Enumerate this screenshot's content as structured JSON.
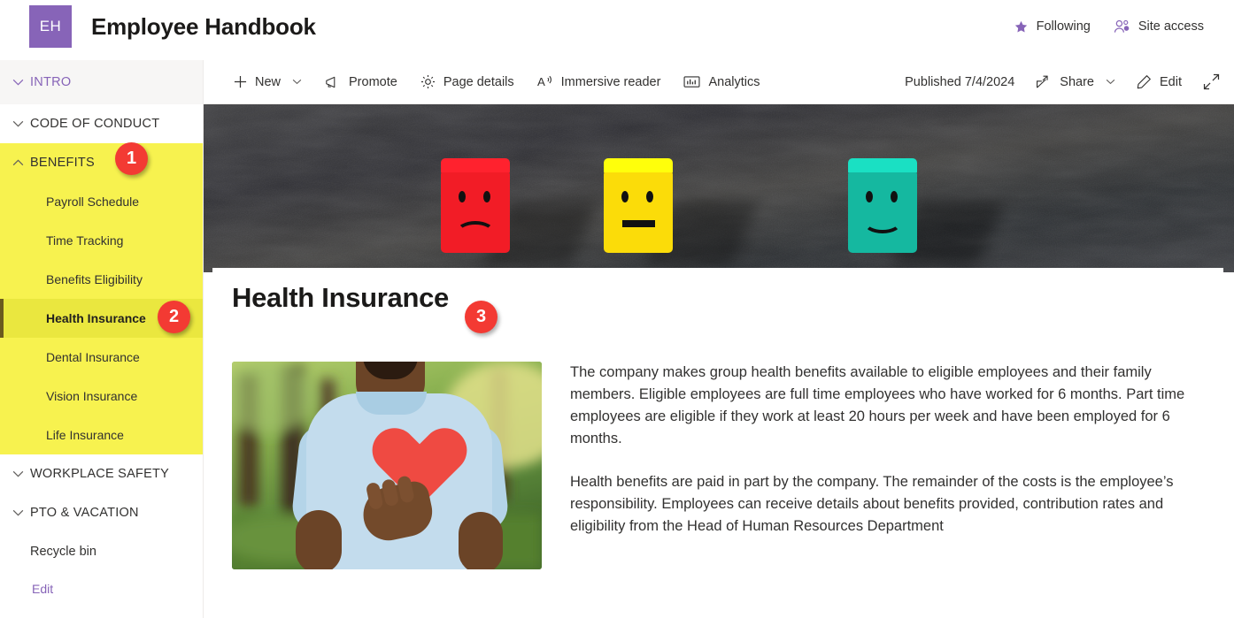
{
  "header": {
    "logo_initials": "EH",
    "site_title": "Employee Handbook",
    "following_label": "Following",
    "site_access_label": "Site access",
    "logo_color": "#8764b8",
    "accent_color": "#8764b8"
  },
  "command_bar": {
    "new_label": "New",
    "promote_label": "Promote",
    "page_details_label": "Page details",
    "immersive_reader_label": "Immersive reader",
    "analytics_label": "Analytics",
    "published_status": "Published 7/4/2024",
    "share_label": "Share",
    "edit_label": "Edit"
  },
  "sidebar": {
    "sections": [
      {
        "label": "INTRO",
        "expanded": true,
        "state": "current",
        "children": []
      },
      {
        "label": "CODE OF CONDUCT",
        "expanded": true,
        "state": "normal",
        "children": []
      },
      {
        "label": "BENEFITS",
        "expanded": true,
        "state": "highlighted",
        "children": [
          {
            "label": "Payroll Schedule",
            "selected": false
          },
          {
            "label": "Time Tracking",
            "selected": false
          },
          {
            "label": "Benefits Eligibility",
            "selected": false
          },
          {
            "label": "Health Insurance",
            "selected": true
          },
          {
            "label": "Dental Insurance",
            "selected": false
          },
          {
            "label": "Vision Insurance",
            "selected": false
          },
          {
            "label": "Life Insurance",
            "selected": false
          }
        ]
      },
      {
        "label": "WORKPLACE SAFETY",
        "expanded": true,
        "state": "normal",
        "children": []
      },
      {
        "label": "PTO & VACATION",
        "expanded": true,
        "state": "normal",
        "children": []
      }
    ],
    "recycle_bin_label": "Recycle bin",
    "edit_label": "Edit",
    "highlight_color": "#f7f24f",
    "selected_color": "#eae73f"
  },
  "hero": {
    "alt": "Three painted wooden blocks on a dark concrete wall showing a red sad face, a yellow neutral face and a teal happy face",
    "cubes": [
      {
        "name": "sad-face-block",
        "color": "#f21c26",
        "mood": "sad"
      },
      {
        "name": "neutral-face-block",
        "color": "#fbdc09",
        "mood": "neutral"
      },
      {
        "name": "happy-face-block",
        "color": "#15b8a0",
        "mood": "happy"
      }
    ]
  },
  "page": {
    "title": "Health Insurance",
    "image_alt": "Man in a light blue t-shirt holding a red paper heart over his chest in a park",
    "paragraphs": [
      "The company makes group health benefits available to eligible employees and their family members. Eligible employees are full time employees who have worked for 6 months. Part time employees are eligible if they work at least 20 hours per week and have been employed for 6 months.",
      "Health benefits are paid in part by the company. The remainder of the costs is the employee’s responsibility. Employees can receive details about benefits provided, contribution rates and eligibility from the Head of Human Resources Department"
    ]
  },
  "annotations": [
    {
      "number": "1",
      "target": "benefits-section-header"
    },
    {
      "number": "2",
      "target": "health-insurance-nav-item"
    },
    {
      "number": "3",
      "target": "page-title"
    }
  ],
  "annotation_color": "#f33a33"
}
